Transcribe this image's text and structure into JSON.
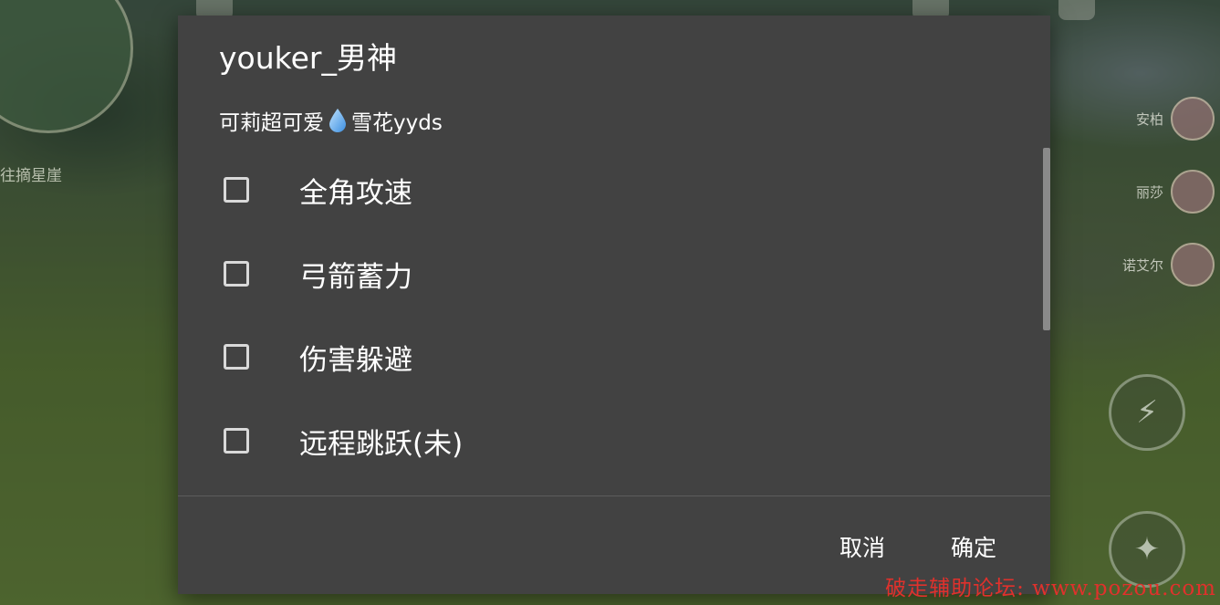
{
  "background": {
    "map_label": "往摘星崖",
    "party": [
      "安柏",
      "丽莎",
      "诺艾尔"
    ]
  },
  "dialog": {
    "title": "youker_男神",
    "subtitle_before": "可莉超可爱",
    "subtitle_icon": "water-drop-icon",
    "subtitle_after": "雪花yyds",
    "options": [
      {
        "label": "全角攻速",
        "checked": false
      },
      {
        "label": "弓箭蓄力",
        "checked": false
      },
      {
        "label": "伤害躲避",
        "checked": false
      },
      {
        "label": "远程跳跃(未)",
        "checked": false
      }
    ],
    "cancel_label": "取消",
    "confirm_label": "确定"
  },
  "watermark": "破走辅助论坛: www.pozou.com",
  "colors": {
    "dialog_bg": "#424242",
    "checkbox_border": "#d9d9d9",
    "watermark": "#e0312c"
  }
}
